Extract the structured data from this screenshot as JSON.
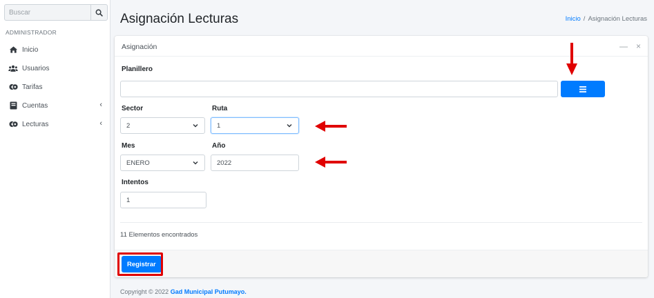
{
  "sidebar": {
    "search_placeholder": "Buscar",
    "header": "ADMINISTRADOR",
    "items": [
      {
        "label": "Inicio",
        "icon": "home-icon",
        "has_submenu": false
      },
      {
        "label": "Usuarios",
        "icon": "users-icon",
        "has_submenu": false
      },
      {
        "label": "Tarifas",
        "icon": "tariff-icon",
        "has_submenu": false
      },
      {
        "label": "Cuentas",
        "icon": "accounts-icon",
        "has_submenu": true
      },
      {
        "label": "Lecturas",
        "icon": "readings-icon",
        "has_submenu": true
      }
    ]
  },
  "header": {
    "title": "Asignación Lecturas",
    "breadcrumb": {
      "home": "Inicio",
      "separator": "/",
      "current": "Asignación Lecturas"
    }
  },
  "card": {
    "title": "Asignación",
    "tools": {
      "minimize": "—",
      "close": "×"
    }
  },
  "form": {
    "planillero": {
      "label": "Planillero",
      "value": ""
    },
    "sector": {
      "label": "Sector",
      "value": "2"
    },
    "ruta": {
      "label": "Ruta",
      "value": "1"
    },
    "mes": {
      "label": "Mes",
      "value": "ENERO"
    },
    "anio": {
      "label": "Año",
      "value": "2022"
    },
    "intentos": {
      "label": "Intentos",
      "value": "1"
    }
  },
  "results": {
    "count_text": "11 Elementos encontrados"
  },
  "actions": {
    "register_label": "Registrar"
  },
  "footer": {
    "prefix": "Copyright © 2022",
    "org": "Gad Municipal Putumayo."
  },
  "colors": {
    "primary": "#007bff",
    "annotation": "#e00000"
  }
}
